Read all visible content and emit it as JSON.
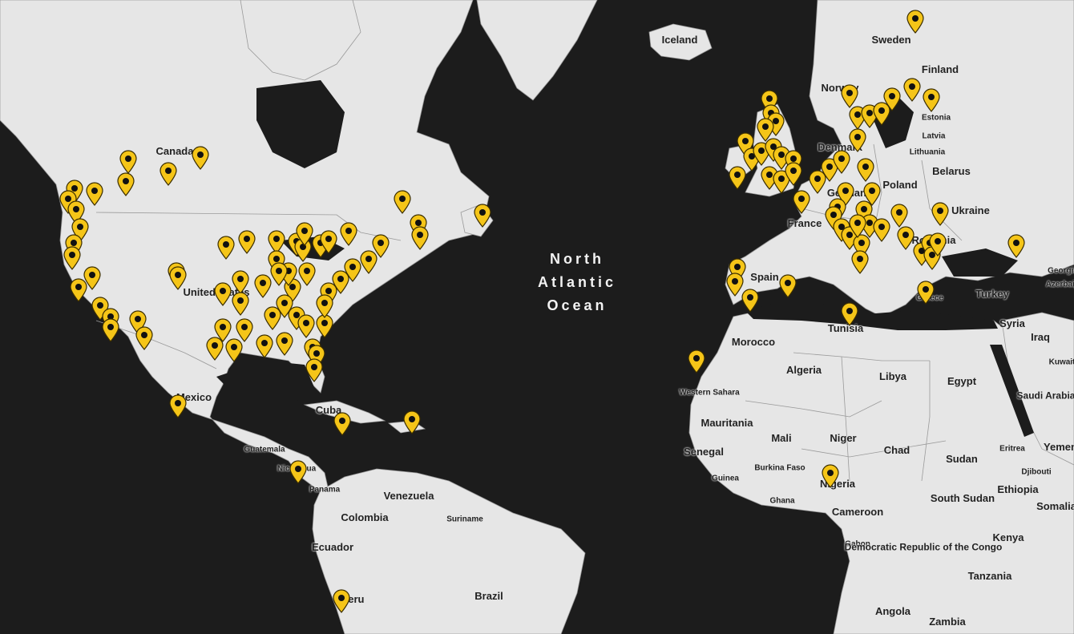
{
  "map": {
    "ocean_label": [
      "North",
      "Atlantic",
      "Ocean"
    ],
    "country_labels": [
      "Canada",
      "United States",
      "Mexico",
      "Cuba",
      "Guatemala",
      "Nicaragua",
      "Panama",
      "Venezuela",
      "Colombia",
      "Suriname",
      "Ecuador",
      "Peru",
      "Brazil",
      "Iceland",
      "Sweden",
      "Finland",
      "Norway",
      "Estonia",
      "Latvia",
      "Lithuania",
      "Denmark",
      "Poland",
      "Belarus",
      "Ukraine",
      "Germany",
      "France",
      "Romania",
      "Spain",
      "Turkey",
      "Georgia",
      "Azerbaijan",
      "Greece",
      "Syria",
      "Iraq",
      "Kuwait",
      "Morocco",
      "Tunisia",
      "Algeria",
      "Libya",
      "Egypt",
      "Saudi Arabia",
      "Western Sahara",
      "Mauritania",
      "Mali",
      "Niger",
      "Chad",
      "Sudan",
      "Eritrea",
      "Djibouti",
      "Yemen",
      "Senegal",
      "Burkina Faso",
      "Guinea",
      "Ghana",
      "Nigeria",
      "Ethiopia",
      "South Sudan",
      "Somalia",
      "Cameroon",
      "Gabon",
      "Kenya",
      "Democratic Republic of the Congo",
      "Tanzania",
      "Angola",
      "Zambia"
    ],
    "marker_color": "#f5c518",
    "marker_icon": "map-pin-icon",
    "water_color": "#1c1c1c",
    "land_color": "#e6e6e6"
  }
}
